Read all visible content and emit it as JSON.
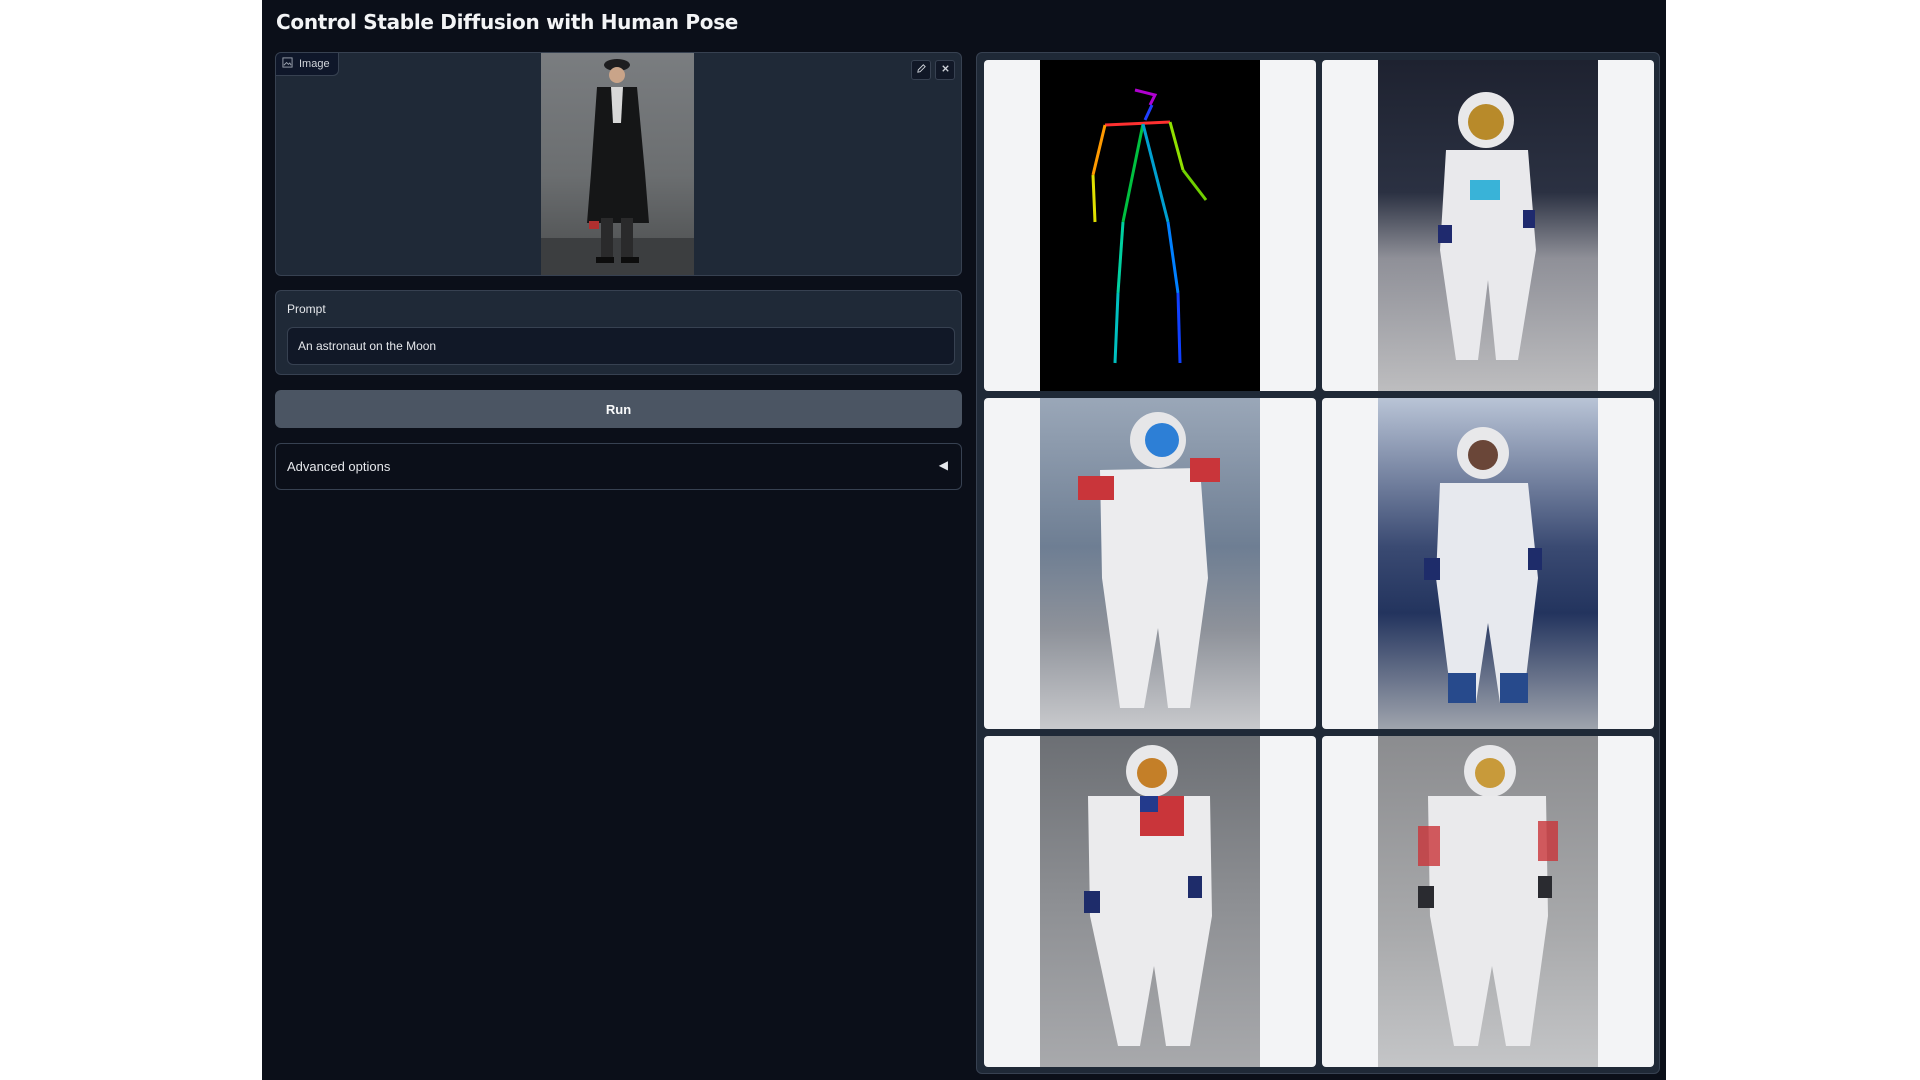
{
  "page": {
    "title": "Control Stable Diffusion with Human Pose"
  },
  "image_input": {
    "label": "Image"
  },
  "prompt": {
    "label": "Prompt",
    "value": "An astronaut on the Moon"
  },
  "run_button": {
    "label": "Run"
  },
  "advanced": {
    "label": "Advanced options",
    "arrow": "◀"
  },
  "gallery": {
    "items": [
      {
        "kind": "pose-skeleton"
      },
      {
        "kind": "astronaut-image"
      },
      {
        "kind": "astronaut-image"
      },
      {
        "kind": "astronaut-image"
      },
      {
        "kind": "astronaut-image"
      },
      {
        "kind": "astronaut-image"
      }
    ]
  },
  "colors": {
    "app_bg": "#0b0f19",
    "panel_bg": "#1f2937",
    "border": "#374151",
    "button": "#4b5563"
  }
}
